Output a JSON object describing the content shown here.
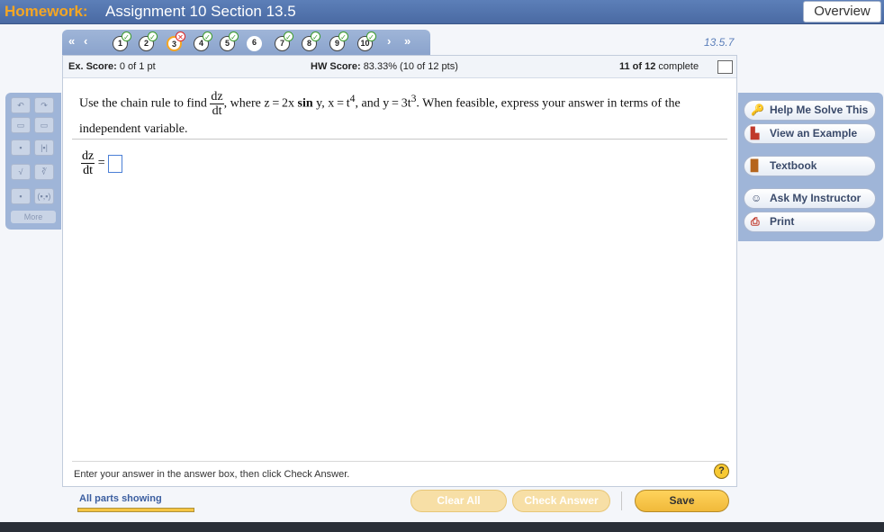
{
  "header": {
    "label": "Homework:",
    "title": "Assignment 10 Section 13.5",
    "overview_label": "Overview"
  },
  "nav": {
    "first_arrow": "«",
    "prev_arrow": "‹",
    "next_arrow": "›",
    "last_arrow": "»",
    "questions": [
      {
        "n": "1",
        "status": "ok"
      },
      {
        "n": "2",
        "status": "ok"
      },
      {
        "n": "3",
        "status": "x"
      },
      {
        "n": "4",
        "status": "ok"
      },
      {
        "n": "5",
        "status": "ok"
      },
      {
        "n": "6",
        "status": "none"
      },
      {
        "n": "7",
        "status": "ok"
      },
      {
        "n": "8",
        "status": "ok"
      },
      {
        "n": "9",
        "status": "ok"
      },
      {
        "n": "10",
        "status": "ok"
      }
    ],
    "current": "3",
    "version": "13.5.7"
  },
  "score": {
    "ex_label": "Ex. Score:",
    "ex_value": "0 of 1 pt",
    "hw_label": "HW Score:",
    "hw_value": "83.33% (10 of 12 pts)",
    "complete_count": "11 of 12",
    "complete_label": "complete"
  },
  "question": {
    "before": "Use the chain rule to find",
    "frac_num": "dz",
    "frac_den": "dt",
    "where": ", where z = 2x",
    "sin": "sin",
    "mid": "y, x = t",
    "exp1": "4",
    "mid2": ", and y = 3t",
    "exp2": "3",
    "after": ". When feasible, express your answer in terms of the independent variable."
  },
  "answer": {
    "num": "dz",
    "den": "dt",
    "eq": "="
  },
  "footer_msg": "Enter your answer in the answer box, then click Check Answer.",
  "help_icon_glyph": "?",
  "tools": {
    "more_label": "More"
  },
  "right_panel": {
    "help_solve": "Help Me Solve This",
    "view_example": "View an Example",
    "textbook": "Textbook",
    "ask_instructor": "Ask My Instructor",
    "print": "Print"
  },
  "bottom": {
    "all_parts": "All parts showing",
    "clear_all": "Clear All",
    "check_answer": "Check Answer",
    "save": "Save"
  },
  "colors": {
    "accent": "#f5a623",
    "header_bg": "#4a6aa3",
    "panel_bg": "#9fb5d8",
    "link_blue": "#3b5ea0"
  }
}
